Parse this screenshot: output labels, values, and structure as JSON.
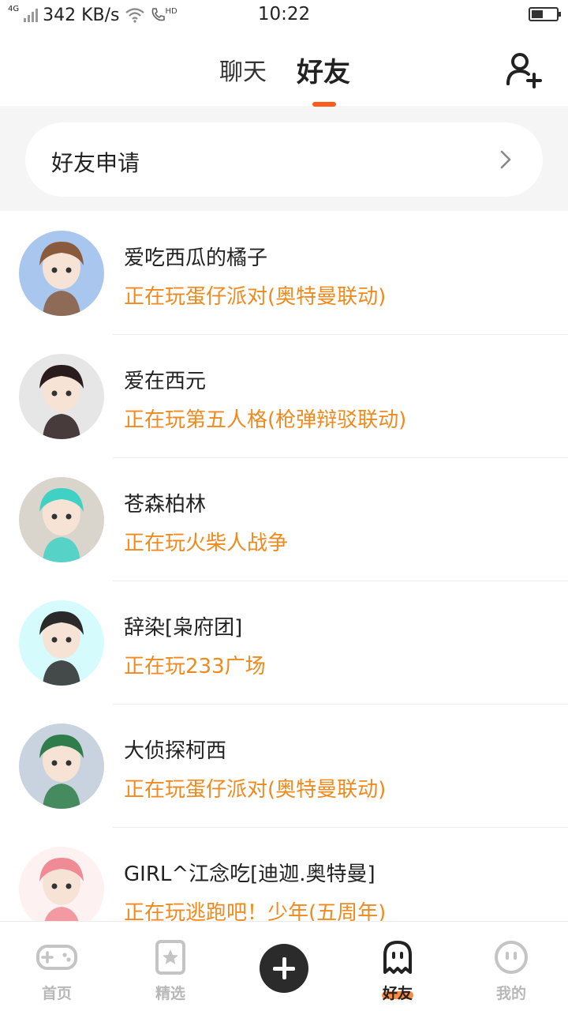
{
  "status_bar": {
    "network": "4G",
    "speed": "342 KB/s",
    "call_label": "HD",
    "time": "10:22",
    "battery_level": 0.45
  },
  "header": {
    "tabs": [
      {
        "label": "聊天",
        "active": false
      },
      {
        "label": "好友",
        "active": true
      }
    ],
    "add_friend_icon": "add-user-icon"
  },
  "friend_request": {
    "label": "好友申请",
    "icon": "chevron-right-icon"
  },
  "friends": [
    {
      "name": "爱吃西瓜的橘子",
      "status": "正在玩蛋仔派对(奥特曼联动)",
      "avatar_bg": "#a9c6ef",
      "avatar_fg": "#8a5a3c"
    },
    {
      "name": "爱在西元",
      "status": "正在玩第五人格(枪弹辩驳联动)",
      "avatar_bg": "#e6e6e6",
      "avatar_fg": "#2a1c1c"
    },
    {
      "name": "苍森柏林",
      "status": "正在玩火柴人战争",
      "avatar_bg": "#d9d4cc",
      "avatar_fg": "#3fd1c4"
    },
    {
      "name": "辞染[枭府团]",
      "status": "正在玩233广场",
      "avatar_bg": "#d6fbfd",
      "avatar_fg": "#2a2a2a"
    },
    {
      "name": "大侦探柯西",
      "status": "正在玩蛋仔派对(奥特曼联动)",
      "avatar_bg": "#c9d3df",
      "avatar_fg": "#2f7d4a"
    },
    {
      "name": "GIRL^江念吃[迪迦.奥特曼]",
      "status": "正在玩逃跑吧！少年(五周年)",
      "avatar_bg": "#fdf1f1",
      "avatar_fg": "#f08a94"
    }
  ],
  "bottom_nav": {
    "items": [
      {
        "label": "首页",
        "icon": "gamepad-icon",
        "active": false
      },
      {
        "label": "精选",
        "icon": "star-card-icon",
        "active": false
      },
      {
        "label": "好友",
        "icon": "ghost-icon",
        "active": true
      },
      {
        "label": "我的",
        "icon": "face-icon",
        "active": false
      }
    ],
    "center_icon": "plus-icon"
  },
  "colors": {
    "accent": "#ff5b1c",
    "status_text": "#f08a1e",
    "nav_inactive": "#b8b8b8"
  }
}
